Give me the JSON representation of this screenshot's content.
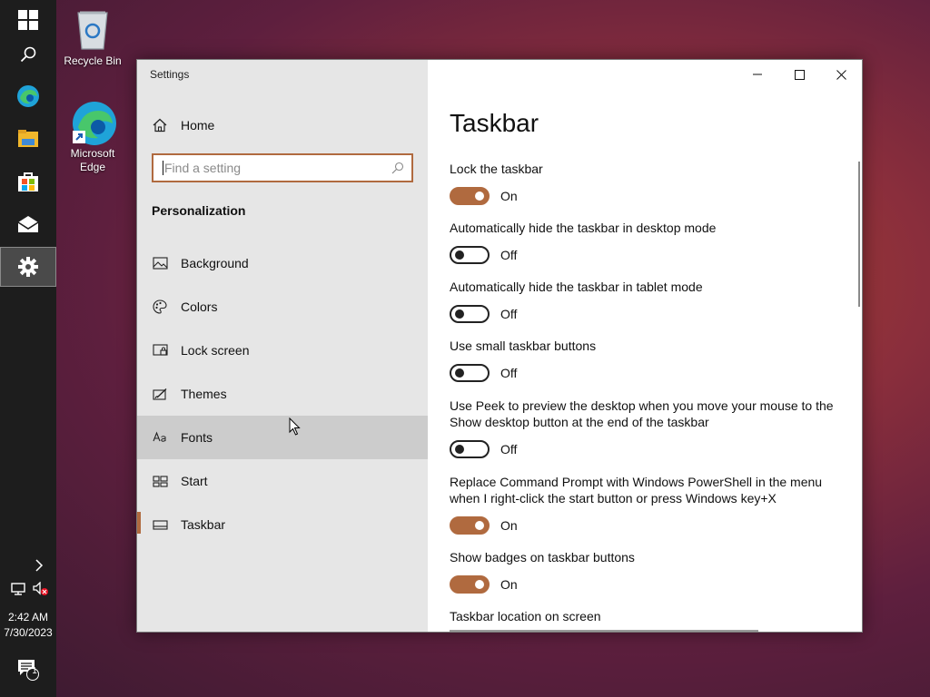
{
  "desktop": {
    "icons": [
      {
        "label": "Recycle Bin",
        "icon": "recycle-bin-icon"
      },
      {
        "label": "Microsoft Edge",
        "icon": "edge-icon"
      }
    ]
  },
  "taskbar": {
    "clock_time": "2:42 AM",
    "clock_date": "7/30/2023",
    "notification_count": "1",
    "buttons": [
      "start-icon",
      "search-icon",
      "edge-icon",
      "file-explorer-icon",
      "store-icon",
      "mail-icon",
      "settings-icon"
    ]
  },
  "window": {
    "title": "Settings",
    "nav": {
      "home_label": "Home",
      "search_placeholder": "Find a setting",
      "section": "Personalization",
      "items": [
        {
          "label": "Background",
          "icon": "picture-icon"
        },
        {
          "label": "Colors",
          "icon": "palette-icon"
        },
        {
          "label": "Lock screen",
          "icon": "lock-screen-icon"
        },
        {
          "label": "Themes",
          "icon": "themes-icon"
        },
        {
          "label": "Fonts",
          "icon": "fonts-icon"
        },
        {
          "label": "Start",
          "icon": "start-layout-icon"
        },
        {
          "label": "Taskbar",
          "icon": "taskbar-icon"
        }
      ],
      "hovered": "Fonts",
      "selected": "Taskbar"
    },
    "content": {
      "title": "Taskbar",
      "settings": [
        {
          "label": "Lock the taskbar",
          "state": "On"
        },
        {
          "label": "Automatically hide the taskbar in desktop mode",
          "state": "Off"
        },
        {
          "label": "Automatically hide the taskbar in tablet mode",
          "state": "Off"
        },
        {
          "label": "Use small taskbar buttons",
          "state": "Off"
        },
        {
          "label": "Use Peek to preview the desktop when you move your mouse to the Show desktop button at the end of the taskbar",
          "state": "Off"
        },
        {
          "label": "Replace Command Prompt with Windows PowerShell in the menu when I right-click the start button or press Windows key+X",
          "state": "On"
        },
        {
          "label": "Show badges on taskbar buttons",
          "state": "On"
        }
      ],
      "location_label": "Taskbar location on screen"
    },
    "accent_color": "#b06a3f"
  }
}
